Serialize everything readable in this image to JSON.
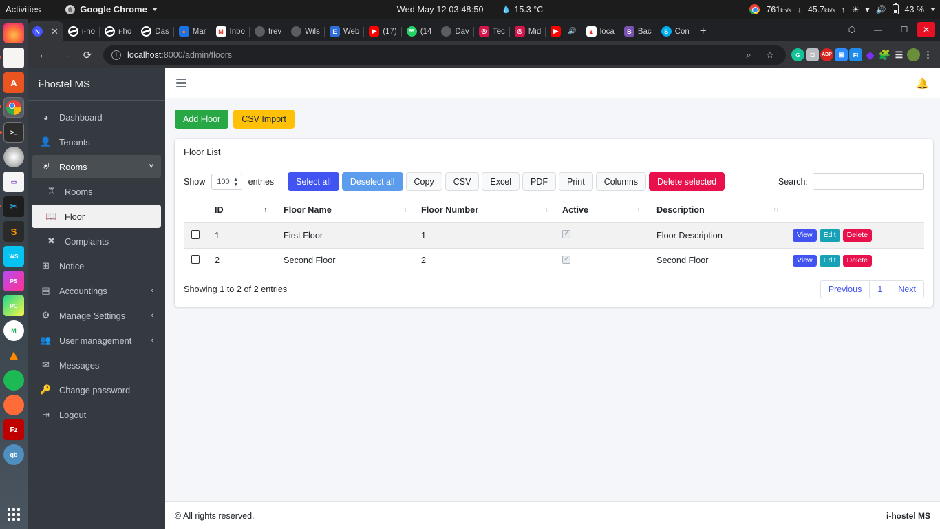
{
  "gnome": {
    "activities": "Activities",
    "app_name": "Google Chrome",
    "clock": "Wed May 12  03:48:50",
    "temperature": "15.3 °C",
    "download_speed": "761",
    "download_unit": "kb/s",
    "upload_speed": "45.7",
    "upload_unit": "kb/s",
    "battery": "43 %"
  },
  "chrome": {
    "tabs": [
      {
        "label": "",
        "icon": "notion-icon",
        "active": true
      },
      {
        "label": "i-ho",
        "icon": "globe-icon",
        "active": false
      },
      {
        "label": "i-ho",
        "icon": "globe-icon",
        "active": false
      },
      {
        "label": "Das",
        "icon": "globe-icon",
        "active": false
      },
      {
        "label": "Mar",
        "icon": "basketball-icon",
        "active": false
      },
      {
        "label": "Inbo",
        "icon": "gmail-icon",
        "active": false
      },
      {
        "label": "trev",
        "icon": "github-icon",
        "active": false
      },
      {
        "label": "Wils",
        "icon": "github-icon",
        "active": false
      },
      {
        "label": "Web",
        "icon": "evernote-icon",
        "active": false
      },
      {
        "label": "(17)",
        "icon": "youtube-icon",
        "active": false
      },
      {
        "label": "(14",
        "icon": "whatsapp-icon",
        "active": false
      },
      {
        "label": "Dav",
        "icon": "github-icon",
        "active": false
      },
      {
        "label": "Tec",
        "icon": "camera-icon",
        "active": false
      },
      {
        "label": "Mid",
        "icon": "camera-icon",
        "active": false
      },
      {
        "label": "",
        "icon": "youtube-icon",
        "active": false
      },
      {
        "label": "loca",
        "icon": "laravel-icon",
        "active": false
      },
      {
        "label": "Bac",
        "icon": "bootstrap-icon",
        "active": false
      },
      {
        "label": "Con",
        "icon": "skype-icon",
        "active": false
      }
    ],
    "new_tab_label": "+",
    "url_host": "localhost",
    "url_path": ":8000/admin/floors",
    "extensions": [
      "grammarly-icon",
      "pocket-icon",
      "adblock-icon",
      "zoom-icon",
      "font-icon",
      "diamond-icon",
      "puzzle-icon",
      "reading-list-icon",
      "profile-avatar",
      "menu-icon"
    ]
  },
  "sidebar": {
    "brand": "i-hostel MS",
    "items": [
      {
        "label": "Dashboard",
        "icon": "dashboard-icon",
        "state": "normal",
        "chevron": ""
      },
      {
        "label": "Tenants",
        "icon": "person-icon",
        "state": "normal",
        "chevron": ""
      },
      {
        "label": "Rooms",
        "icon": "bell-concierge-icon",
        "state": "open",
        "chevron": "˅"
      },
      {
        "label": "Rooms",
        "icon": "chess-rook-icon",
        "state": "child",
        "chevron": ""
      },
      {
        "label": "Floor",
        "icon": "book-open-icon",
        "state": "active",
        "chevron": ""
      },
      {
        "label": "Complaints",
        "icon": "times-icon",
        "state": "child",
        "chevron": ""
      },
      {
        "label": "Notice",
        "icon": "columns-icon",
        "state": "normal",
        "chevron": ""
      },
      {
        "label": "Accountings",
        "icon": "credit-card-icon",
        "state": "normal",
        "chevron": "‹"
      },
      {
        "label": "Manage Settings",
        "icon": "cogs-icon",
        "state": "normal",
        "chevron": "‹"
      },
      {
        "label": "User management",
        "icon": "users-icon",
        "state": "normal",
        "chevron": "‹"
      },
      {
        "label": "Messages",
        "icon": "envelope-icon",
        "state": "normal",
        "chevron": ""
      },
      {
        "label": "Change password",
        "icon": "key-icon",
        "state": "normal",
        "chevron": ""
      },
      {
        "label": "Logout",
        "icon": "sign-out-icon",
        "state": "normal",
        "chevron": ""
      }
    ]
  },
  "toolbar": {
    "add_floor": "Add Floor",
    "csv_import": "CSV Import"
  },
  "card": {
    "title": "Floor List"
  },
  "datatable": {
    "show_label": "Show",
    "entries_label": "entries",
    "page_length": "100",
    "buttons": [
      {
        "label": "Select all",
        "style": "primary"
      },
      {
        "label": "Deselect all",
        "style": "info"
      },
      {
        "label": "Copy",
        "style": "default"
      },
      {
        "label": "CSV",
        "style": "default"
      },
      {
        "label": "Excel",
        "style": "default"
      },
      {
        "label": "PDF",
        "style": "default"
      },
      {
        "label": "Print",
        "style": "default"
      },
      {
        "label": "Columns",
        "style": "default"
      },
      {
        "label": "Delete selected",
        "style": "danger"
      }
    ],
    "search_label": "Search:",
    "search_value": "",
    "columns": [
      "",
      "ID",
      "Floor Name",
      "Floor Number",
      "Active",
      "Description",
      ""
    ],
    "sort_column": "ID",
    "rows": [
      {
        "id": "1",
        "floor_name": "First Floor",
        "floor_number": "1",
        "active": true,
        "description": "Floor Description",
        "actions": [
          "View",
          "Edit",
          "Delete"
        ]
      },
      {
        "id": "2",
        "floor_name": "Second Floor",
        "floor_number": "2",
        "active": true,
        "description": "Second Floor",
        "actions": [
          "View",
          "Edit",
          "Delete"
        ]
      }
    ],
    "info": "Showing 1 to 2 of 2 entries",
    "pagination": [
      "Previous",
      "1",
      "Next"
    ]
  },
  "footer": {
    "copyright": "© All rights reserved.",
    "brand": "i-hostel MS"
  }
}
